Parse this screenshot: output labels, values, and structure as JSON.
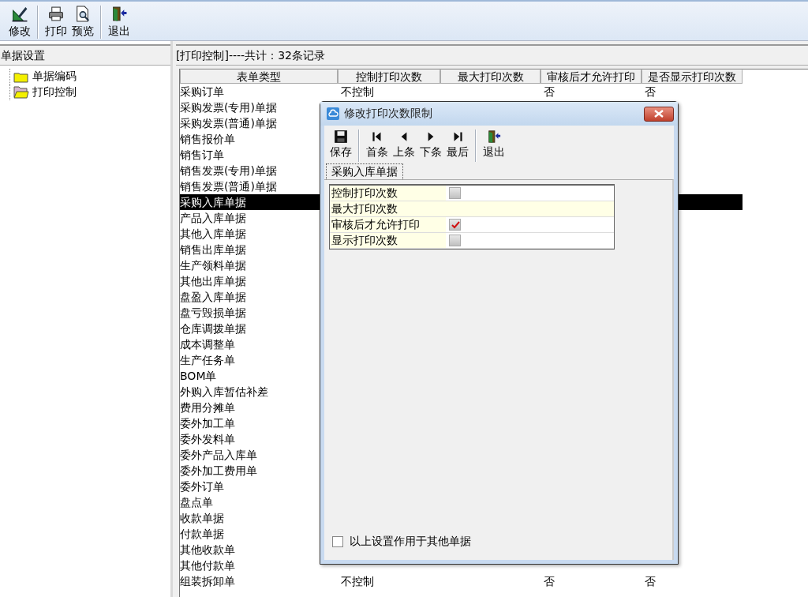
{
  "toolbar": [
    {
      "label": "修改",
      "kind": "edit"
    },
    {
      "label": "打印",
      "kind": "print"
    },
    {
      "label": "预览",
      "kind": "preview"
    },
    {
      "label": "退出",
      "kind": "exit"
    }
  ],
  "sidebar": {
    "title": "单据设置",
    "items": [
      {
        "label": "单据编码",
        "selected": false
      },
      {
        "label": "打印控制",
        "selected": true
      }
    ]
  },
  "list": {
    "title": "[打印控制]----共计：32条记录",
    "columns": [
      "表单类型",
      "控制打印次数",
      "最大打印次数",
      "审核后才允许打印",
      "是否显示打印次数"
    ],
    "rows": [
      {
        "cells": [
          "采购订单",
          "不控制",
          null,
          "否",
          "否"
        ],
        "selected": false
      },
      {
        "cells": [
          "采购发票(专用)单据"
        ],
        "selected": false
      },
      {
        "cells": [
          "采购发票(普通)单据"
        ],
        "selected": false
      },
      {
        "cells": [
          "销售报价单"
        ],
        "selected": false
      },
      {
        "cells": [
          "销售订单"
        ],
        "selected": false
      },
      {
        "cells": [
          "销售发票(专用)单据"
        ],
        "selected": false
      },
      {
        "cells": [
          "销售发票(普通)单据"
        ],
        "selected": false
      },
      {
        "cells": [
          "采购入库单据"
        ],
        "selected": true
      },
      {
        "cells": [
          "产品入库单据"
        ],
        "selected": false
      },
      {
        "cells": [
          "其他入库单据"
        ],
        "selected": false
      },
      {
        "cells": [
          "销售出库单据"
        ],
        "selected": false
      },
      {
        "cells": [
          "生产领料单据"
        ],
        "selected": false
      },
      {
        "cells": [
          "其他出库单据"
        ],
        "selected": false
      },
      {
        "cells": [
          "盘盈入库单据"
        ],
        "selected": false
      },
      {
        "cells": [
          "盘亏毁损单据"
        ],
        "selected": false
      },
      {
        "cells": [
          "仓库调拨单据"
        ],
        "selected": false
      },
      {
        "cells": [
          "成本调整单"
        ],
        "selected": false
      },
      {
        "cells": [
          "生产任务单"
        ],
        "selected": false
      },
      {
        "cells": [
          "BOM单"
        ],
        "selected": false
      },
      {
        "cells": [
          "外购入库暂估补差"
        ],
        "selected": false
      },
      {
        "cells": [
          "费用分摊单"
        ],
        "selected": false
      },
      {
        "cells": [
          "委外加工单"
        ],
        "selected": false
      },
      {
        "cells": [
          "委外发料单"
        ],
        "selected": false
      },
      {
        "cells": [
          "委外产品入库单"
        ],
        "selected": false
      },
      {
        "cells": [
          "委外加工费用单"
        ],
        "selected": false
      },
      {
        "cells": [
          "委外订单"
        ],
        "selected": false
      },
      {
        "cells": [
          "盘点单"
        ],
        "selected": false
      },
      {
        "cells": [
          "收款单据"
        ],
        "selected": false
      },
      {
        "cells": [
          "付款单据"
        ],
        "selected": false
      },
      {
        "cells": [
          "其他收款单"
        ],
        "selected": false
      },
      {
        "cells": [
          "其他付款单"
        ],
        "selected": false
      },
      {
        "cells": [
          "组装拆卸单",
          "不控制",
          null,
          "否",
          "否"
        ],
        "selected": false
      }
    ]
  },
  "dialog": {
    "title": "修改打印次数限制",
    "toolbar": [
      {
        "label": "保存",
        "kind": "save"
      },
      {
        "label": "首条",
        "kind": "first"
      },
      {
        "label": "上条",
        "kind": "prev"
      },
      {
        "label": "下条",
        "kind": "next"
      },
      {
        "label": "最后",
        "kind": "last"
      },
      {
        "label": "退出",
        "kind": "exit"
      }
    ],
    "tab": {
      "label": "采购入库单据",
      "selected": true
    },
    "fields": [
      {
        "label": "控制打印次数",
        "kind": "checkbox",
        "checked": false
      },
      {
        "label": "最大打印次数",
        "kind": "text"
      },
      {
        "label": "审核后才允许打印",
        "kind": "checkbox",
        "checked": true
      },
      {
        "label": "显示打印次数",
        "kind": "checkbox",
        "checked": false
      }
    ],
    "apply_all": {
      "label": "以上设置作用于其他单据",
      "checked": false
    }
  }
}
